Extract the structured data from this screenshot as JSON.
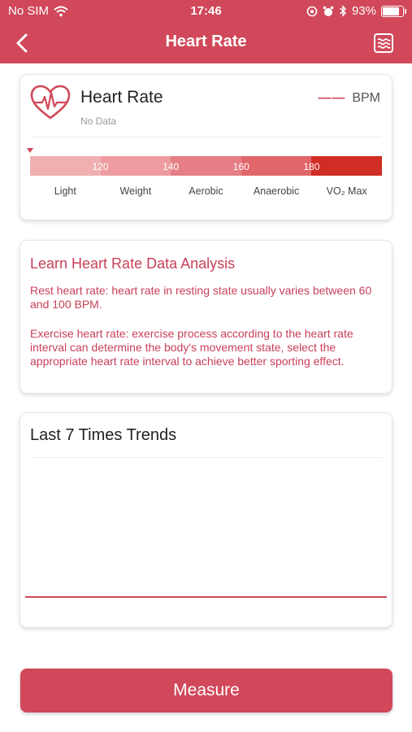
{
  "status_bar": {
    "carrier": "No SIM",
    "time": "17:46",
    "battery_percent": "93%",
    "battery_level": 0.93
  },
  "nav": {
    "title": "Heart Rate",
    "back_icon": "chevron-left-icon",
    "menu_icon": "list-icon"
  },
  "heart_card": {
    "title": "Heart Rate",
    "subtitle": "No Data",
    "value_placeholder": "——",
    "unit": "BPM",
    "zones": [
      {
        "label": "Light",
        "color": "#f0b0b0"
      },
      {
        "label": "Weight",
        "color": "#ee9c9f"
      },
      {
        "label": "Aerobic",
        "color": "#e57f85"
      },
      {
        "label": "Anaerobic",
        "color": "#e0666a"
      },
      {
        "label": "VO₂ Max",
        "color": "#d02d24"
      }
    ],
    "thresholds": [
      "120",
      "140",
      "160",
      "180"
    ]
  },
  "learn_card": {
    "title": "Learn Heart Rate Data Analysis",
    "rest_text": "Rest heart rate: heart rate in resting state usually varies between 60 and 100 BPM.",
    "exercise_text": "Exercise heart rate: exercise process according to the heart rate interval can determine the body's movement state, select the appropriate heart rate interval to achieve better sporting effect."
  },
  "trends_card": {
    "title": "Last 7 Times Trends"
  },
  "measure_button": {
    "label": "Measure"
  },
  "colors": {
    "accent": "#d0485a",
    "text_accent": "#c84059"
  }
}
